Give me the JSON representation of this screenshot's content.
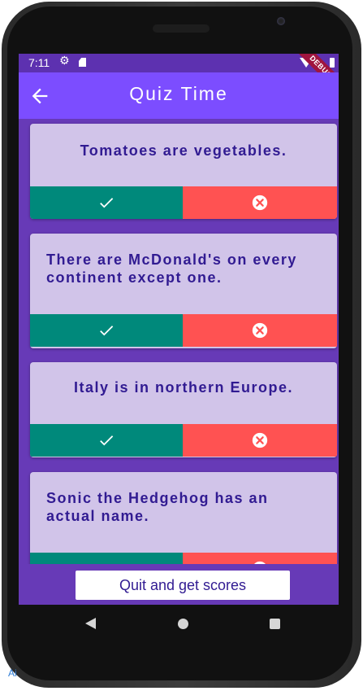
{
  "status_bar": {
    "time": "7:11",
    "debug_label": "DEBUG"
  },
  "app_bar": {
    "title": "Quiz Time",
    "back_icon": "arrow-back-icon"
  },
  "questions": [
    {
      "text": "Tomatoes are vegetables.",
      "true_icon": "check-icon",
      "false_icon": "cancel-icon"
    },
    {
      "text": "There are McDonald's on every continent except one.",
      "true_icon": "check-icon",
      "false_icon": "cancel-icon"
    },
    {
      "text": "Italy is in northern Europe.",
      "true_icon": "check-icon",
      "false_icon": "cancel-icon"
    },
    {
      "text": "Sonic the Hedgehog has an actual name.",
      "true_icon": "check-icon",
      "false_icon": "cancel-icon"
    }
  ],
  "quit_button": {
    "label": "Quit and get scores"
  },
  "nav_bar": {
    "back": "nav-back-icon",
    "home": "nav-home-icon",
    "recents": "nav-recents-icon"
  },
  "corner_text": "Ai",
  "colors": {
    "primary": "#673ab7",
    "app_bar": "#7c4dff",
    "card": "#d1c4e9",
    "question_text": "#311b92",
    "true_button": "#00897b",
    "false_button": "#ff5252"
  }
}
